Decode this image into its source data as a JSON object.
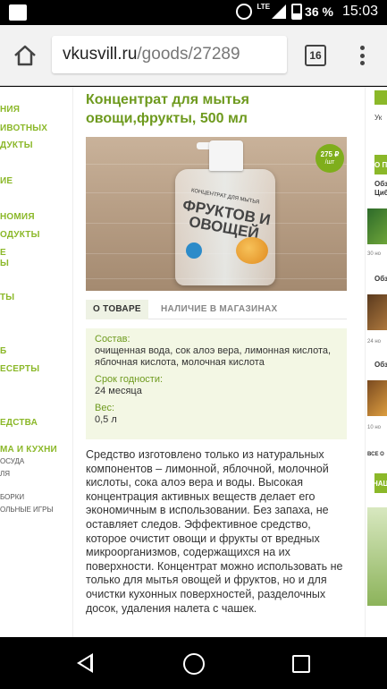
{
  "status_bar": {
    "lte": "LTE",
    "battery": "36 %",
    "battery_level": 0.36,
    "time": "15:03",
    "icons": [
      "notification-icon",
      "alarm-icon",
      "signal-icon",
      "battery-icon"
    ]
  },
  "browser": {
    "url_domain": "vkusvill.ru",
    "url_path": "/goods/27289",
    "tab_count": "16",
    "icons": [
      "home-icon",
      "tabs-icon",
      "menu-icon"
    ]
  },
  "left_nav": {
    "items": [
      "НИЯ",
      "ИВОТНЫХ",
      "ДУКТЫ",
      "ИЕ",
      "НОМИЯ",
      "ОДУКТЫ",
      "Е",
      "Ы",
      "ТЫ",
      "Б",
      "ЕСЕРТЫ",
      "ЕДСТВА",
      "МА И КУХНИ"
    ],
    "subitems": [
      "ОСУДА",
      "ЛЯ",
      "БОРКИ",
      "ОЛЬНЫЕ ИГРЫ"
    ]
  },
  "product": {
    "title": "Концентрат для мытья овощи,фрукты, 500 мл",
    "price": "275 ₽",
    "price_unit": "/шт",
    "image_label_top": "КОНЦЕНТРАТ ДЛЯ МЫТЬЯ",
    "image_label_main": "ФРУКТОВ И ОВОЩЕЙ",
    "image_badge": "3,5+"
  },
  "tabs": [
    {
      "label": "О ТОВАРЕ",
      "active": true
    },
    {
      "label": "НАЛИЧИЕ В МАГАЗИНАХ",
      "active": false
    }
  ],
  "specs": {
    "composition_label": "Состав:",
    "composition_value": "очищенная вода, сок алоэ вера, лимонная кислота, яблочная кислота, молочная кислота",
    "shelf_life_label": "Срок годности:",
    "shelf_life_value": "24 месяца",
    "weight_label": "Вес:",
    "weight_value": "0,5 л"
  },
  "description": "Средство изготовлено только из натуральных компонентов – лимонной, яблочной, молочной кислоты, сока алоэ вера и воды. Высокая концентрация активных веществ делает его экономичным в использовании. Без запаха, не оставляет следов. Эффективное средство, которое очистит овощи и фрукты от вредных микроорганизмов, содержащихся на их поверхности. Концентрат можно использовать не только для мытья овощей и фруктов, но и для очистки кухонных поверхностей, разделочных досок, удаления налета с чашек.",
  "right_col": {
    "select_label": "Ук",
    "section_header": "О П",
    "item_titles": [
      "Обз",
      "Циб",
      "Обз",
      "Обз"
    ],
    "item_dates": [
      "30 но",
      "24 но",
      "10 но"
    ],
    "all_link": "ВСЕ О",
    "section2_header": "НАЦ"
  },
  "colors": {
    "accent_green": "#8bb829",
    "title_green": "#6e9a1e",
    "spec_bg": "#f3f7e4"
  },
  "nav_bar": {
    "icons": [
      "back-icon",
      "home-circle-icon",
      "recent-apps-icon"
    ]
  }
}
